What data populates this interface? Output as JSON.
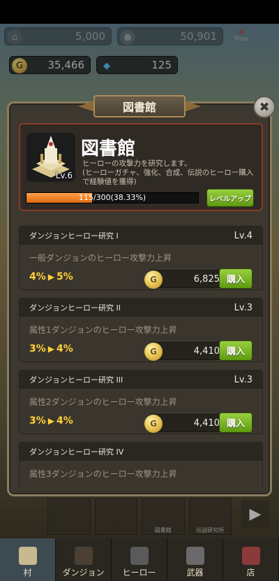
{
  "top": {
    "village_count": "5,000",
    "top_right_value": "50,901",
    "free_label": "Free",
    "gold": "35,466",
    "gems": "125"
  },
  "modal": {
    "tab_title": "図書館",
    "building_level": "Lv.6",
    "title": "図書館",
    "description": "ヒーローの攻撃力を研究します。\n(ヒーローガチャ、強化、合成、伝説のヒーロー購入で経験値を獲得)",
    "xp_text": "115/300(38.33%)",
    "xp_progress": 0.3833,
    "levelup_label": "レベルアップ",
    "close_label": "✖"
  },
  "research": [
    {
      "name": "ダンジョンヒーロー研究 I",
      "level": "Lv.4",
      "desc": "一般ダンジョンのヒーロー攻撃力上昇",
      "from": "4%",
      "to": "5%",
      "cost": "6,825",
      "buy": "購入"
    },
    {
      "name": "ダンジョンヒーロー研究 II",
      "level": "Lv.3",
      "desc": "属性1ダンジョンのヒーロー攻撃力上昇",
      "from": "3%",
      "to": "4%",
      "cost": "4,410",
      "buy": "購入"
    },
    {
      "name": "ダンジョンヒーロー研究 III",
      "level": "Lv.3",
      "desc": "属性2ダンジョンのヒーロー攻撃力上昇",
      "from": "3%",
      "to": "4%",
      "cost": "4,410",
      "buy": "購入"
    },
    {
      "name": "ダンジョンヒーロー研究 IV",
      "level": "",
      "desc": "属性3ダンジョンのヒーロー攻撃力上昇",
      "from": "",
      "to": "",
      "cost": "",
      "buy": ""
    }
  ],
  "nav": [
    {
      "label": "村",
      "active": true
    },
    {
      "label": "ダンジョン",
      "active": false
    },
    {
      "label": "ヒーロー",
      "active": false
    },
    {
      "label": "武器",
      "active": false
    },
    {
      "label": "店",
      "active": false
    }
  ],
  "subnav": [
    "",
    "",
    "図書館",
    "伝説研究所"
  ],
  "arrow_glyph": "▶",
  "colors": {
    "accent_green": "#7cb82a",
    "xp_orange": "#f08a2a",
    "effect_yellow": "#ffd23a"
  }
}
